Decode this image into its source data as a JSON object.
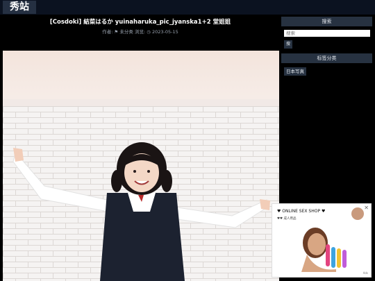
{
  "site": {
    "title": "秀站"
  },
  "post": {
    "title": "[Cosdoki] 結菜はるか yuinaharuka_pic_jyanska1+2 堂姐姐",
    "meta": {
      "author_label": "作者:",
      "category_label": "未分类",
      "views_label": "浏览:",
      "date": "2023-05-15"
    }
  },
  "sidebar": {
    "search": {
      "heading": "搜索",
      "placeholder": "搜索",
      "button_label": "搜"
    },
    "categories": {
      "heading": "标签分类",
      "items": [
        "日本写真"
      ]
    }
  },
  "ad": {
    "title": "♥ ONLINE SEX SHOP ♥",
    "subtitle": "♥♥ 成人用品",
    "close": "✕",
    "small": "Ads"
  },
  "colors": {
    "topbar": "#0b1220",
    "accent": "#273241",
    "sidebar_bg": "#000000"
  }
}
